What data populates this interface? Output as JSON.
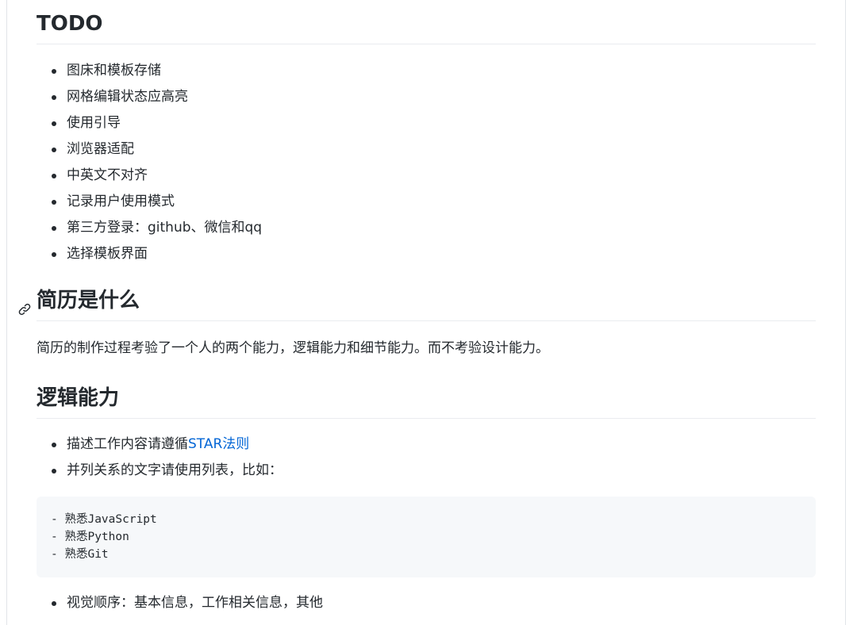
{
  "todo": {
    "title": "TODO",
    "items": [
      "图床和模板存储",
      "网格编辑状态应高亮",
      "使用引导",
      "浏览器适配",
      "中英文不对齐",
      "记录用户使用模式",
      "第三方登录：github、微信和qq",
      "选择模板界面"
    ]
  },
  "resume": {
    "title": "简历是什么",
    "paragraph": "简历的制作过程考验了一个人的两个能力，逻辑能力和细节能力。而不考验设计能力。"
  },
  "logic": {
    "title": "逻辑能力",
    "item1_prefix": "描述工作内容请遵循",
    "item1_link": "STAR法则",
    "item2": "并列关系的文字请使用列表，比如：",
    "code_lines": [
      "- 熟悉JavaScript",
      "- 熟悉Python",
      "- 熟悉Git"
    ],
    "item3": "视觉顺序：基本信息，工作相关信息，其他"
  },
  "icons": {
    "anchor": "link-icon"
  },
  "colors": {
    "link": "#0366d6",
    "code_bg": "#f6f8fa",
    "text": "#24292e"
  }
}
